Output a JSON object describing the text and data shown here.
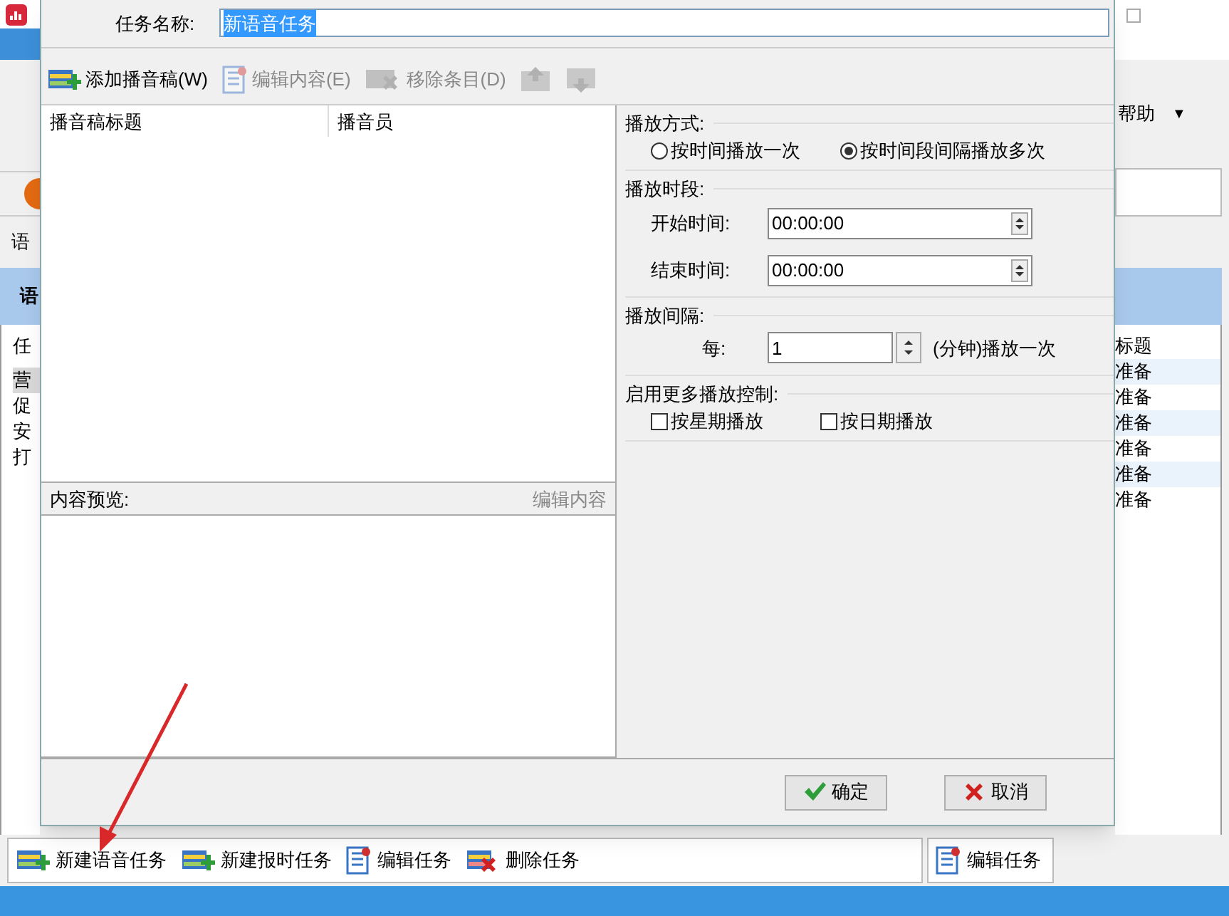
{
  "background_window": {
    "left_texts": [
      "语",
      "语"
    ],
    "left_column": "任",
    "left_rows": [
      {
        "text": "营",
        "selected": true
      },
      {
        "text": "促",
        "selected": false
      },
      {
        "text": "安",
        "selected": false
      },
      {
        "text": "打",
        "selected": false
      }
    ],
    "menu": "帮助",
    "menu_caret": "▼",
    "list_column": "标题",
    "list_rows": [
      "准备",
      "准备",
      "准备",
      "准备",
      "准备",
      "准备"
    ],
    "bottom_toolbar": [
      {
        "kind": "add",
        "label": "新建语音任务"
      },
      {
        "kind": "add",
        "label": "新建报时任务"
      },
      {
        "kind": "edit",
        "label": "编辑任务"
      },
      {
        "kind": "delete",
        "label": "删除任务"
      }
    ],
    "side_toolbar": [
      {
        "kind": "edit",
        "label": "编辑任务"
      }
    ]
  },
  "dialog": {
    "task_name_label": "任务名称:",
    "task_name": {
      "value": "新语音任务",
      "text_selected": true
    },
    "toolbar": [
      {
        "kind": "add",
        "label": "添加播音稿(W)",
        "disabled": false
      },
      {
        "kind": "edit",
        "label": "编辑内容(E)",
        "disabled": true
      },
      {
        "kind": "remove",
        "label": "移除条目(D)",
        "disabled": true
      },
      {
        "kind": "up",
        "disabled": true
      },
      {
        "kind": "down",
        "disabled": true
      }
    ],
    "list_columns": [
      "播音稿标题",
      "播音员"
    ],
    "preview_label": "内容预览:",
    "preview_action": {
      "label": "编辑内容",
      "disabled": true
    },
    "play_mode": {
      "label": "播放方式:",
      "options": [
        {
          "label": "按时间播放一次",
          "selected": false
        },
        {
          "label": "按时间段间隔播放多次",
          "selected": true
        }
      ]
    },
    "period": {
      "label": "播放时段:",
      "fields": [
        {
          "label": "开始时间:",
          "value": "00:00:00"
        },
        {
          "label": "结束时间:",
          "value": "00:00:00"
        }
      ]
    },
    "interval": {
      "label": "播放间隔:",
      "every_label": "每:",
      "value": "1",
      "unit": "(分钟)播放一次"
    },
    "more_control": {
      "label": "启用更多播放控制:",
      "options": [
        {
          "label": "按星期播放",
          "checked": false
        },
        {
          "label": "按日期播放",
          "checked": false
        }
      ]
    },
    "buttons": [
      {
        "kind": "ok",
        "label": "确定"
      },
      {
        "kind": "cancel",
        "label": "取消"
      }
    ]
  }
}
